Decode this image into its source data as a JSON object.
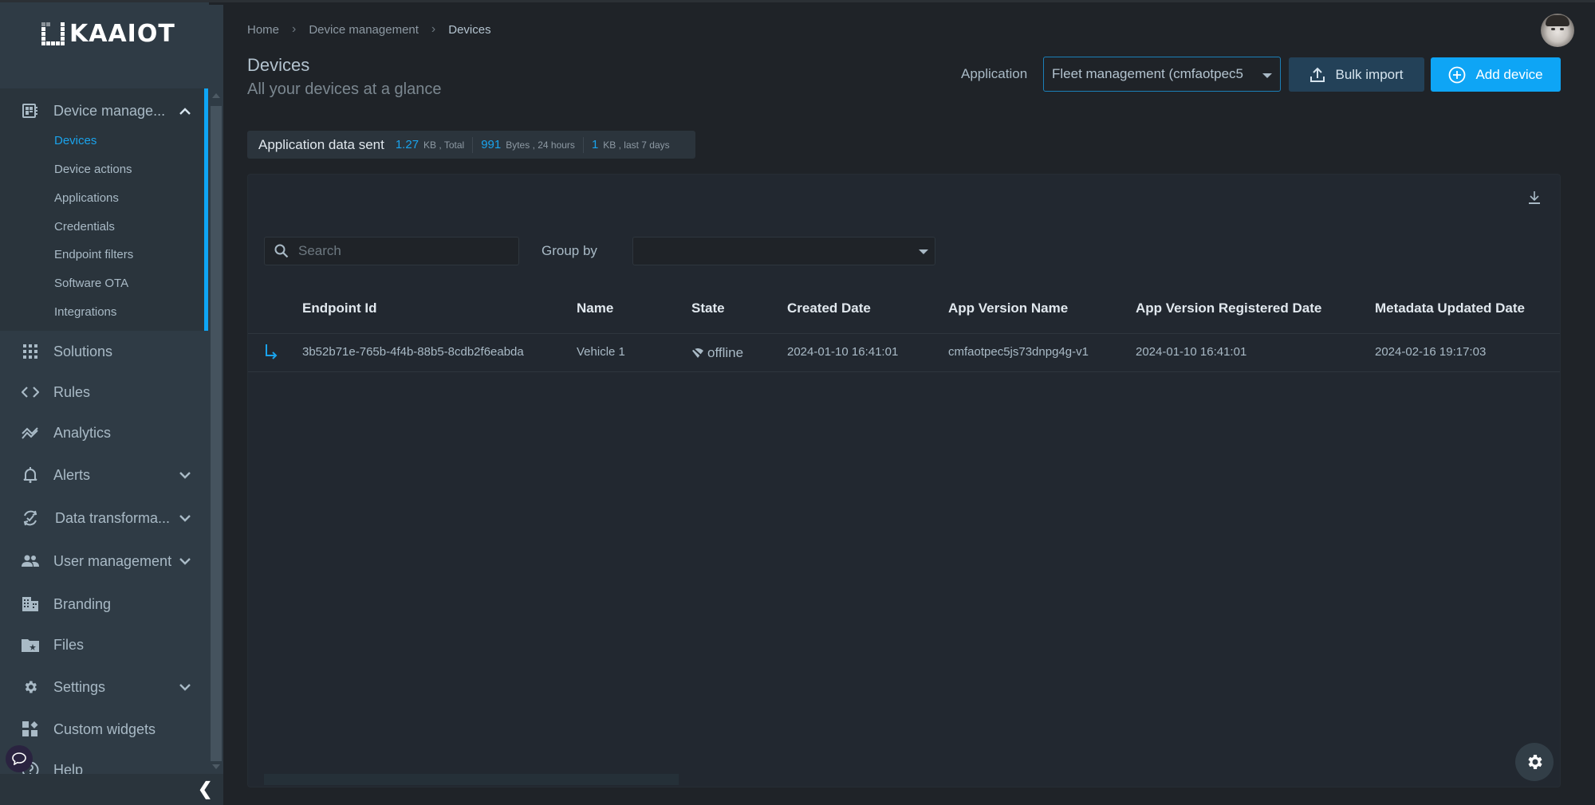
{
  "brand": {
    "name": "KAAIOT",
    "accent": "#0ea5f5"
  },
  "sidebar": {
    "group_open": {
      "label": "Device manage...",
      "icon": "device-management-icon",
      "items": [
        {
          "label": "Devices",
          "active": true
        },
        {
          "label": "Device actions"
        },
        {
          "label": "Applications"
        },
        {
          "label": "Credentials"
        },
        {
          "label": "Endpoint filters"
        },
        {
          "label": "Software OTA"
        },
        {
          "label": "Integrations"
        }
      ]
    },
    "items": [
      {
        "label": "Solutions",
        "icon": "grid-icon"
      },
      {
        "label": "Rules",
        "icon": "code-icon"
      },
      {
        "label": "Analytics",
        "icon": "analytics-icon"
      },
      {
        "label": "Alerts",
        "icon": "bell-icon",
        "expandable": true
      },
      {
        "label": "Data transforma...",
        "icon": "sync-icon",
        "expandable": true
      },
      {
        "label": "User management",
        "icon": "users-icon",
        "expandable": true
      },
      {
        "label": "Branding",
        "icon": "building-icon"
      },
      {
        "label": "Files",
        "icon": "folder-star-icon"
      },
      {
        "label": "Settings",
        "icon": "gear-icon",
        "expandable": true
      },
      {
        "label": "Custom widgets",
        "icon": "widgets-icon"
      },
      {
        "label": "Help",
        "icon": "help-icon"
      }
    ],
    "collapse_glyph": "❮"
  },
  "breadcrumb": [
    "Home",
    "Device management",
    "Devices"
  ],
  "page": {
    "title": "Devices",
    "subtitle": "All your devices at a glance"
  },
  "toolbar": {
    "application_label": "Application",
    "application_value": "Fleet management (cmfaotpec5",
    "bulk_import_label": "Bulk import",
    "add_device_label": "Add device"
  },
  "stats": {
    "title": "Application data sent",
    "total_value": "1.27",
    "total_unit": "KB , Total",
    "day_value": "991",
    "day_unit": "Bytes , 24 hours",
    "week_value": "1",
    "week_unit": "KB , last 7 days"
  },
  "filters": {
    "search_placeholder": "Search",
    "search_value": "",
    "group_by_label": "Group by",
    "group_by_value": ""
  },
  "table": {
    "columns": [
      "Endpoint Id",
      "Name",
      "State",
      "Created Date",
      "App Version Name",
      "App Version Registered Date",
      "Metadata Updated Date"
    ],
    "rows": [
      {
        "endpoint_id": "3b52b71e-765b-4f4b-88b5-8cdb2f6eabda",
        "name": "Vehicle 1",
        "state": "offline",
        "created_date": "2024-01-10 16:41:01",
        "app_version_name": "cmfaotpec5js73dnpg4g-v1",
        "app_version_registered_date": "2024-01-10 16:41:01",
        "metadata_updated_date": "2024-02-16 19:17:03"
      }
    ]
  }
}
